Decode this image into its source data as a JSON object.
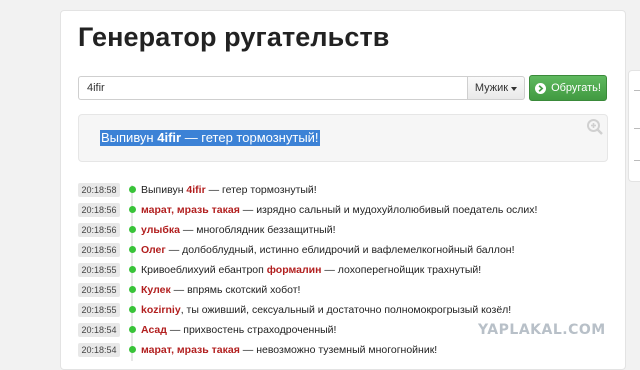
{
  "page": {
    "title": "Генератор ругательств"
  },
  "form": {
    "name_value": "4ifir",
    "gender_label": "Мужик",
    "submit_label": "Обругать!"
  },
  "result": {
    "pre": "Выпивун ",
    "name": "4ifir",
    "post": " — гетер тормознутый!"
  },
  "history": [
    {
      "time": "20:18:58",
      "pre": "Выпивун ",
      "name": "4ifir",
      "post": " — гетер тормознутый!"
    },
    {
      "time": "20:18:56",
      "pre": "",
      "name": "марат, мразь такая",
      "post": " — изрядно сальный и мудохуйлолюбивый поедатель ослих!"
    },
    {
      "time": "20:18:56",
      "pre": "",
      "name": "улыбка",
      "post": " — многоблядник беззащитный!"
    },
    {
      "time": "20:18:56",
      "pre": "",
      "name": "Олег",
      "post": " — долбоблудный, истинно еблидрочий и вафлемелкогнойный баллон!"
    },
    {
      "time": "20:18:55",
      "pre": "Кривоеблихуий ебантроп ",
      "name": "формалин",
      "post": " — лохоперегнойщик трахнутый!"
    },
    {
      "time": "20:18:55",
      "pre": "",
      "name": "Кулек",
      "post": " — впрямь скотский хобот!"
    },
    {
      "time": "20:18:55",
      "pre": "",
      "name": "kozirniy",
      "post": ", ты оживший, сексуальный и достаточно полномокрогрызый козёл!"
    },
    {
      "time": "20:18:54",
      "pre": "",
      "name": "Асад",
      "post": " — прихвостень страходроченный!"
    },
    {
      "time": "20:18:54",
      "pre": "",
      "name": "марат, мразь такая",
      "post": " — невозможно туземный многогнойник!"
    }
  ],
  "watermark": "YAPLAKAL.COM",
  "icons": {
    "zoom": "zoom-in-icon",
    "chevron": "chevron-right-icon",
    "caret": "caret-down-icon"
  },
  "colors": {
    "accent_green": "#449d44",
    "name_red": "#b21f1f",
    "selection": "#3c82d6",
    "status_dot": "#39c339"
  }
}
